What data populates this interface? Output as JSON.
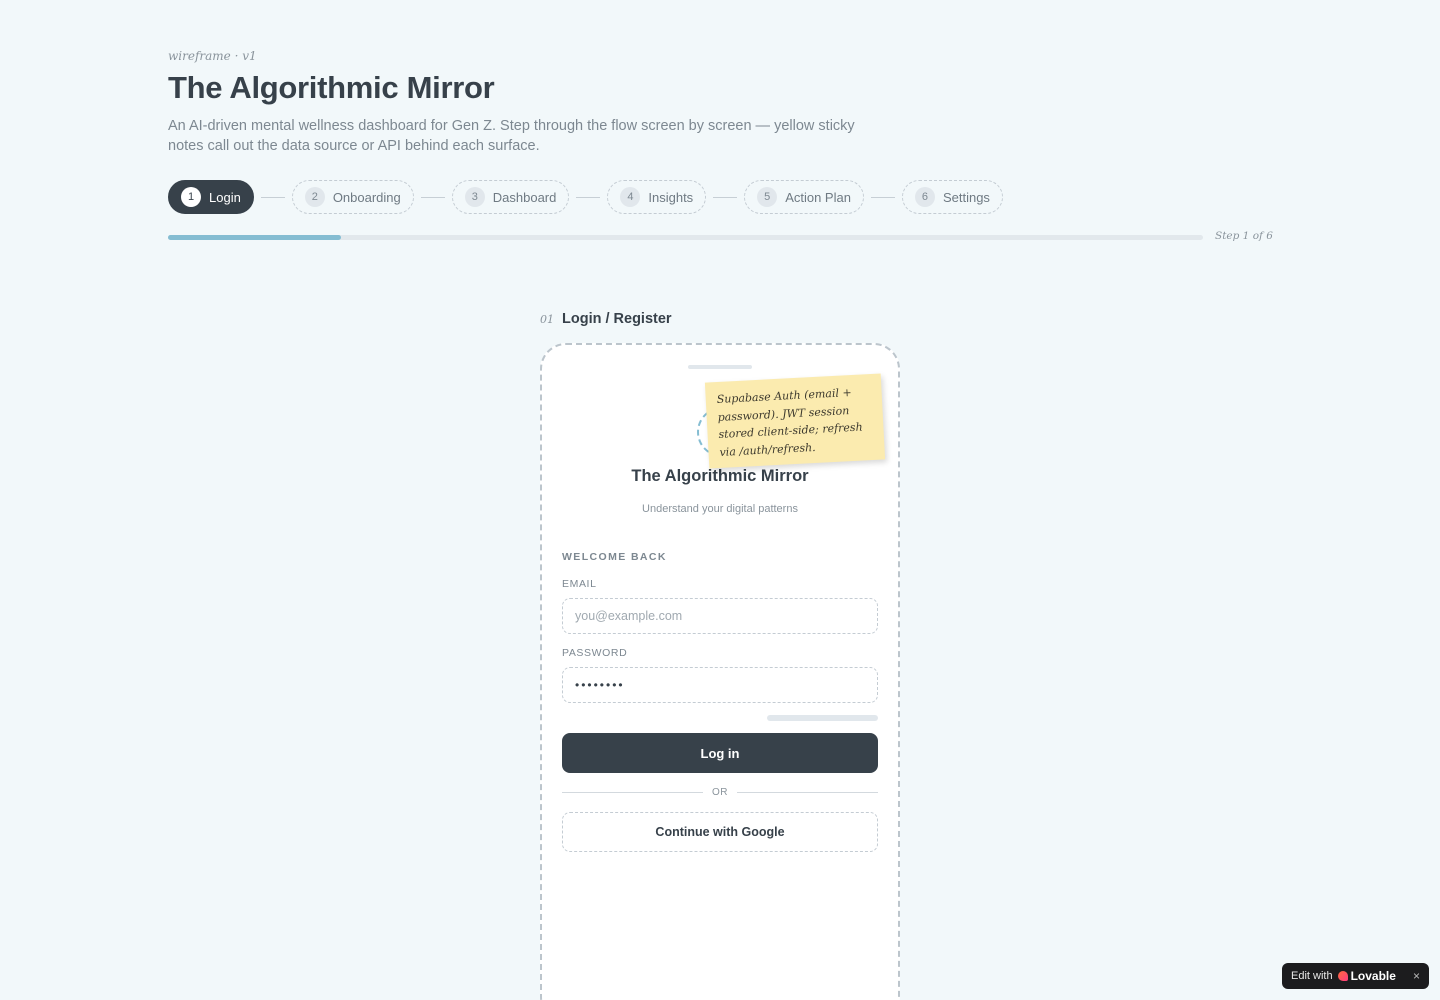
{
  "header": {
    "kicker": "wireframe · v1",
    "title": "The Algorithmic Mirror",
    "subtitle": "An AI-driven mental wellness dashboard for Gen Z. Step through the flow screen by screen — yellow sticky notes call out the data source or API behind each surface."
  },
  "stepper": {
    "steps": [
      {
        "num": "1",
        "label": "Login",
        "active": true
      },
      {
        "num": "2",
        "label": "Onboarding",
        "active": false
      },
      {
        "num": "3",
        "label": "Dashboard",
        "active": false
      },
      {
        "num": "4",
        "label": "Insights",
        "active": false
      },
      {
        "num": "5",
        "label": "Action Plan",
        "active": false
      },
      {
        "num": "6",
        "label": "Settings",
        "active": false
      }
    ],
    "progress_fraction": 0.1667,
    "progress_text": "Step 1 of 6"
  },
  "screen": {
    "number": "01",
    "name": "Login / Register",
    "app_name": "The Algorithmic Mirror",
    "tagline": "Understand your digital patterns",
    "welcome": "WELCOME BACK",
    "email_label": "EMAIL",
    "email_placeholder": "you@example.com",
    "password_label": "PASSWORD",
    "password_value": "••••••••",
    "login_button": "Log in",
    "or_text": "OR",
    "google_button": "Continue with Google"
  },
  "sticky_note": "Supabase Auth (email + password). JWT session stored client-side; refresh via /auth/refresh.",
  "badge": {
    "edit_with": "Edit with",
    "brand": "Lovable",
    "close": "×"
  },
  "colors": {
    "background": "#f2f8fa",
    "ink": "#37414a",
    "accent": "#85bdd2",
    "sticky": "#fbebaf"
  }
}
